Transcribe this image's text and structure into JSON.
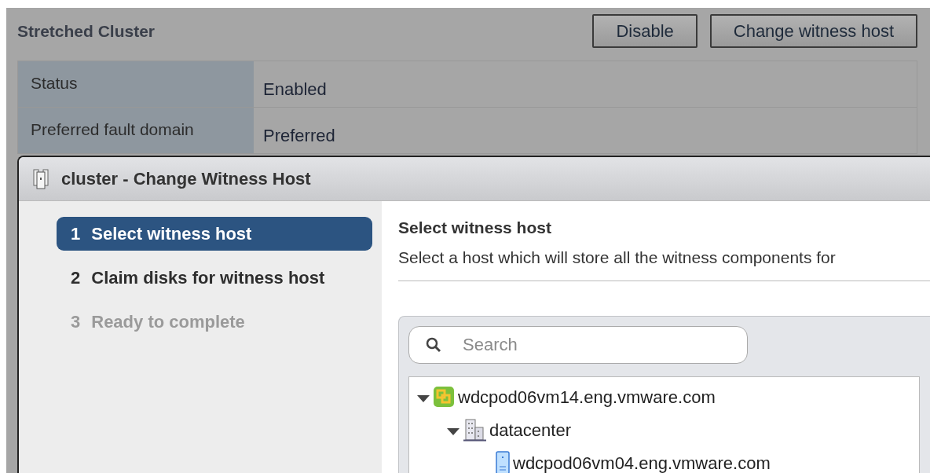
{
  "panel": {
    "title": "Stretched Cluster",
    "buttons": [
      "Disable",
      "Change witness host"
    ],
    "rows": [
      {
        "label": "Status",
        "value": "Enabled"
      },
      {
        "label": "Preferred fault domain",
        "value": "Preferred"
      }
    ]
  },
  "dialog": {
    "title": "cluster - Change Witness Host",
    "steps": [
      {
        "number": "1",
        "label": "Select witness host",
        "selected": true,
        "disabled": false
      },
      {
        "number": "2",
        "label": "Claim disks for witness host",
        "selected": false,
        "disabled": false
      },
      {
        "number": "3",
        "label": "Ready to complete",
        "selected": false,
        "disabled": true
      }
    ],
    "heading": "Select witness host",
    "description": "Select a host which will store all the witness components for",
    "search": {
      "placeholder": "Search"
    },
    "tree": [
      {
        "label": "wdcpod06vm14.eng.vmware.com",
        "kind": "vcenter",
        "expanded": true,
        "children": [
          {
            "label": "datacenter",
            "kind": "datacenter",
            "expanded": true,
            "children": [
              {
                "label": "wdcpod06vm04.eng.vmware.com",
                "kind": "host"
              }
            ]
          }
        ]
      }
    ]
  }
}
